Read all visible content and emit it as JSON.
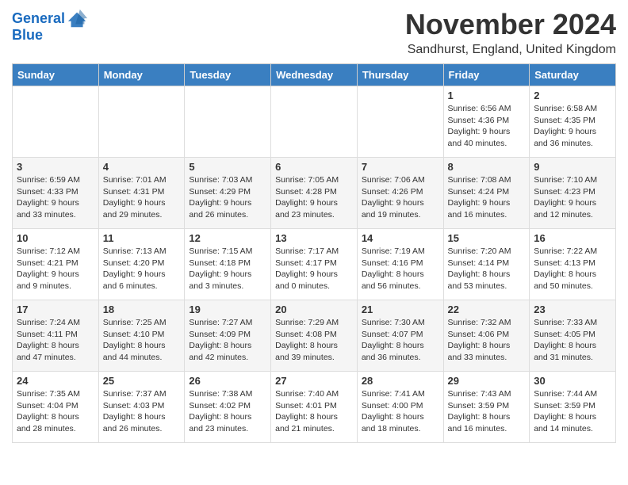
{
  "logo": {
    "line1": "General",
    "line2": "Blue"
  },
  "title": "November 2024",
  "location": "Sandhurst, England, United Kingdom",
  "weekdays": [
    "Sunday",
    "Monday",
    "Tuesday",
    "Wednesday",
    "Thursday",
    "Friday",
    "Saturday"
  ],
  "weeks": [
    [
      {
        "day": "",
        "info": ""
      },
      {
        "day": "",
        "info": ""
      },
      {
        "day": "",
        "info": ""
      },
      {
        "day": "",
        "info": ""
      },
      {
        "day": "",
        "info": ""
      },
      {
        "day": "1",
        "info": "Sunrise: 6:56 AM\nSunset: 4:36 PM\nDaylight: 9 hours and 40 minutes."
      },
      {
        "day": "2",
        "info": "Sunrise: 6:58 AM\nSunset: 4:35 PM\nDaylight: 9 hours and 36 minutes."
      }
    ],
    [
      {
        "day": "3",
        "info": "Sunrise: 6:59 AM\nSunset: 4:33 PM\nDaylight: 9 hours and 33 minutes."
      },
      {
        "day": "4",
        "info": "Sunrise: 7:01 AM\nSunset: 4:31 PM\nDaylight: 9 hours and 29 minutes."
      },
      {
        "day": "5",
        "info": "Sunrise: 7:03 AM\nSunset: 4:29 PM\nDaylight: 9 hours and 26 minutes."
      },
      {
        "day": "6",
        "info": "Sunrise: 7:05 AM\nSunset: 4:28 PM\nDaylight: 9 hours and 23 minutes."
      },
      {
        "day": "7",
        "info": "Sunrise: 7:06 AM\nSunset: 4:26 PM\nDaylight: 9 hours and 19 minutes."
      },
      {
        "day": "8",
        "info": "Sunrise: 7:08 AM\nSunset: 4:24 PM\nDaylight: 9 hours and 16 minutes."
      },
      {
        "day": "9",
        "info": "Sunrise: 7:10 AM\nSunset: 4:23 PM\nDaylight: 9 hours and 12 minutes."
      }
    ],
    [
      {
        "day": "10",
        "info": "Sunrise: 7:12 AM\nSunset: 4:21 PM\nDaylight: 9 hours and 9 minutes."
      },
      {
        "day": "11",
        "info": "Sunrise: 7:13 AM\nSunset: 4:20 PM\nDaylight: 9 hours and 6 minutes."
      },
      {
        "day": "12",
        "info": "Sunrise: 7:15 AM\nSunset: 4:18 PM\nDaylight: 9 hours and 3 minutes."
      },
      {
        "day": "13",
        "info": "Sunrise: 7:17 AM\nSunset: 4:17 PM\nDaylight: 9 hours and 0 minutes."
      },
      {
        "day": "14",
        "info": "Sunrise: 7:19 AM\nSunset: 4:16 PM\nDaylight: 8 hours and 56 minutes."
      },
      {
        "day": "15",
        "info": "Sunrise: 7:20 AM\nSunset: 4:14 PM\nDaylight: 8 hours and 53 minutes."
      },
      {
        "day": "16",
        "info": "Sunrise: 7:22 AM\nSunset: 4:13 PM\nDaylight: 8 hours and 50 minutes."
      }
    ],
    [
      {
        "day": "17",
        "info": "Sunrise: 7:24 AM\nSunset: 4:11 PM\nDaylight: 8 hours and 47 minutes."
      },
      {
        "day": "18",
        "info": "Sunrise: 7:25 AM\nSunset: 4:10 PM\nDaylight: 8 hours and 44 minutes."
      },
      {
        "day": "19",
        "info": "Sunrise: 7:27 AM\nSunset: 4:09 PM\nDaylight: 8 hours and 42 minutes."
      },
      {
        "day": "20",
        "info": "Sunrise: 7:29 AM\nSunset: 4:08 PM\nDaylight: 8 hours and 39 minutes."
      },
      {
        "day": "21",
        "info": "Sunrise: 7:30 AM\nSunset: 4:07 PM\nDaylight: 8 hours and 36 minutes."
      },
      {
        "day": "22",
        "info": "Sunrise: 7:32 AM\nSunset: 4:06 PM\nDaylight: 8 hours and 33 minutes."
      },
      {
        "day": "23",
        "info": "Sunrise: 7:33 AM\nSunset: 4:05 PM\nDaylight: 8 hours and 31 minutes."
      }
    ],
    [
      {
        "day": "24",
        "info": "Sunrise: 7:35 AM\nSunset: 4:04 PM\nDaylight: 8 hours and 28 minutes."
      },
      {
        "day": "25",
        "info": "Sunrise: 7:37 AM\nSunset: 4:03 PM\nDaylight: 8 hours and 26 minutes."
      },
      {
        "day": "26",
        "info": "Sunrise: 7:38 AM\nSunset: 4:02 PM\nDaylight: 8 hours and 23 minutes."
      },
      {
        "day": "27",
        "info": "Sunrise: 7:40 AM\nSunset: 4:01 PM\nDaylight: 8 hours and 21 minutes."
      },
      {
        "day": "28",
        "info": "Sunrise: 7:41 AM\nSunset: 4:00 PM\nDaylight: 8 hours and 18 minutes."
      },
      {
        "day": "29",
        "info": "Sunrise: 7:43 AM\nSunset: 3:59 PM\nDaylight: 8 hours and 16 minutes."
      },
      {
        "day": "30",
        "info": "Sunrise: 7:44 AM\nSunset: 3:59 PM\nDaylight: 8 hours and 14 minutes."
      }
    ]
  ]
}
